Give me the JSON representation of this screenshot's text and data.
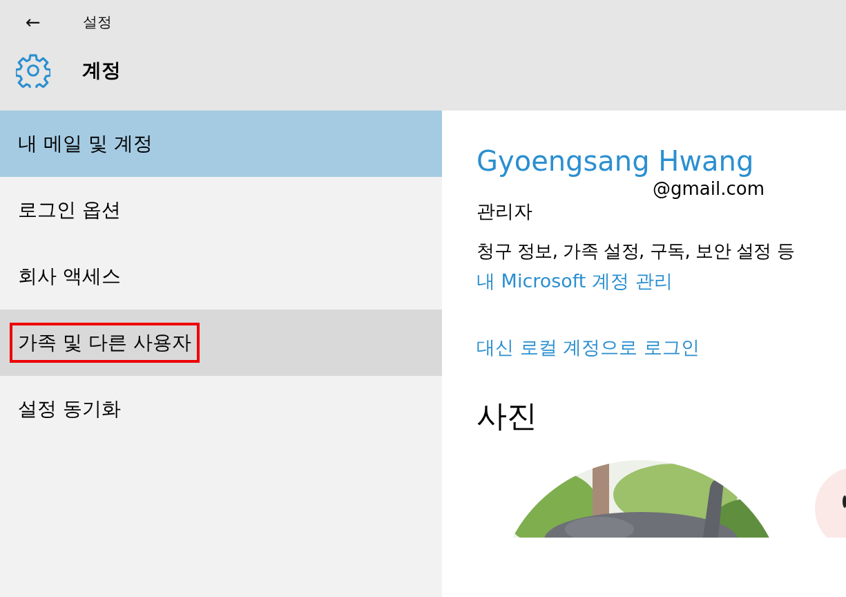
{
  "header": {
    "back_label": "←",
    "app_title": "설정",
    "section_title": "계정"
  },
  "sidebar": {
    "items": [
      {
        "label": "내 메일 및 계정",
        "selected": true,
        "hovered": false,
        "highlighted": false
      },
      {
        "label": "로그인 옵션",
        "selected": false,
        "hovered": false,
        "highlighted": false
      },
      {
        "label": "회사 액세스",
        "selected": false,
        "hovered": false,
        "highlighted": false
      },
      {
        "label": "가족 및 다른 사용자",
        "selected": false,
        "hovered": true,
        "highlighted": true
      },
      {
        "label": "설정 동기화",
        "selected": false,
        "hovered": false,
        "highlighted": false
      }
    ]
  },
  "account": {
    "name": "Gyoengsang Hwang",
    "email": "@gmail.com",
    "role": "관리자",
    "description": "청구 정보, 가족 설정, 구독, 보안 설정 등",
    "manage_link": "내 Microsoft 계정 관리",
    "local_link": "대신 로컬 계정으로 로그인"
  },
  "photo": {
    "heading": "사진",
    "kind": "picture"
  }
}
